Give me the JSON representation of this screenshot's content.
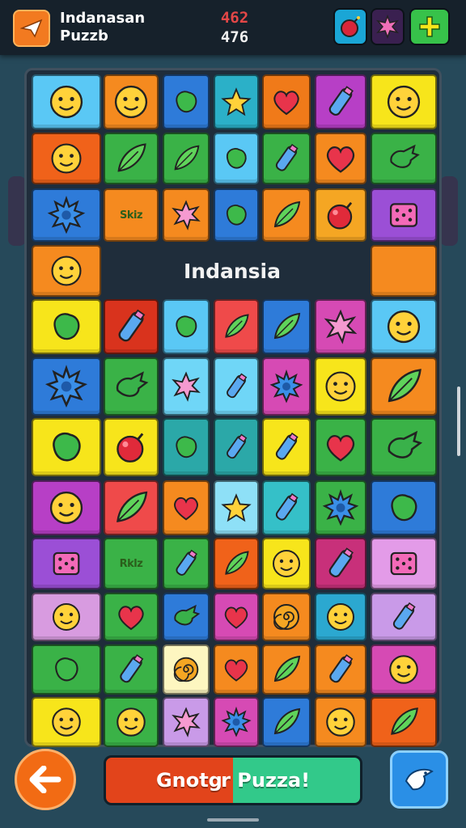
{
  "header": {
    "app_name_line1": "Indanasan",
    "app_name_line2": "Puzzb",
    "score_primary": "462",
    "score_secondary": "476",
    "logo_icon": "paper-plane-icon",
    "buttons": [
      {
        "icon": "bomb-icon",
        "bg": "#1aa6d6"
      },
      {
        "icon": "star-burst-icon",
        "bg": "#3a2050"
      },
      {
        "icon": "plus-icon",
        "bg": "#37c24a"
      }
    ]
  },
  "board": {
    "banner_title": "Indansia",
    "tiles": [
      {
        "c": "#5ac8f5",
        "icon": "smiley-face-icon"
      },
      {
        "c": "#f58a1f",
        "icon": "smiley-face-icon"
      },
      {
        "c": "#2e7bd9",
        "icon": "blob-icon"
      },
      {
        "c": "#2bb0c8",
        "icon": "star-icon"
      },
      {
        "c": "#f07a19",
        "icon": "heart-icon"
      },
      {
        "c": "#b73fc6",
        "icon": "bottle-icon"
      },
      {
        "c": "#f7e51b",
        "icon": "smiley-face-icon"
      },
      {
        "c": "#f0621a",
        "icon": "smiley-face-icon"
      },
      {
        "c": "#3ab247",
        "icon": "leaf-icon"
      },
      {
        "c": "#3ab247",
        "icon": "leaf-icon"
      },
      {
        "c": "#5ac8f5",
        "icon": "blob-icon"
      },
      {
        "c": "#3ab247",
        "icon": "bottle-icon"
      },
      {
        "c": "#f58a1f",
        "icon": "heart-icon"
      },
      {
        "c": "#3ab247",
        "icon": "hand-icon"
      },
      {
        "c": "#2e7bd9",
        "icon": "spiky-ball-icon"
      },
      {
        "c": "#f58a1f",
        "text": "Skiz"
      },
      {
        "c": "#f58a1f",
        "icon": "star-burst-icon"
      },
      {
        "c": "#2e7bd9",
        "icon": "blob-icon"
      },
      {
        "c": "#f58a1f",
        "icon": "leaf-icon"
      },
      {
        "c": "#f5a623",
        "icon": "bomb-icon"
      },
      {
        "c": "#9b4fd6",
        "icon": "dice-icon"
      },
      {
        "c": "#f58a1f",
        "icon": "smiley-face-icon"
      },
      {
        "c": "#f58a1f",
        "icon": "none"
      },
      {
        "c": "#f7e51b",
        "icon": "blob-icon"
      },
      {
        "c": "#d9331d",
        "icon": "bottle-icon"
      },
      {
        "c": "#5ac8f5",
        "icon": "blob-icon"
      },
      {
        "c": "#ef4a4a",
        "icon": "leaf-icon"
      },
      {
        "c": "#2e7bd9",
        "icon": "leaf-icon"
      },
      {
        "c": "#d64ab4",
        "icon": "star-burst-icon"
      },
      {
        "c": "#5ac8f5",
        "icon": "smiley-face-icon"
      },
      {
        "c": "#2e7bd9",
        "icon": "spiky-ball-icon"
      },
      {
        "c": "#3ab247",
        "icon": "hand-icon"
      },
      {
        "c": "#6fd6f7",
        "icon": "star-burst-icon"
      },
      {
        "c": "#6fd6f7",
        "icon": "bottle-icon"
      },
      {
        "c": "#d64ab4",
        "icon": "spiky-ball-icon"
      },
      {
        "c": "#f7e51b",
        "icon": "smiley-face-icon"
      },
      {
        "c": "#f58a1f",
        "icon": "leaf-icon"
      },
      {
        "c": "#f7e51b",
        "icon": "blob-icon"
      },
      {
        "c": "#f7e51b",
        "icon": "bomb-icon"
      },
      {
        "c": "#2ba8a8",
        "icon": "blob-icon"
      },
      {
        "c": "#2ba8a8",
        "icon": "bottle-icon"
      },
      {
        "c": "#f7e51b",
        "icon": "bottle-icon"
      },
      {
        "c": "#3ab247",
        "icon": "heart-icon"
      },
      {
        "c": "#3ab247",
        "icon": "hand-icon"
      },
      {
        "c": "#b73fc6",
        "icon": "smiley-face-icon"
      },
      {
        "c": "#ef4a4a",
        "icon": "leaf-icon"
      },
      {
        "c": "#f58a1f",
        "icon": "heart-icon"
      },
      {
        "c": "#8ee0f7",
        "icon": "star-icon"
      },
      {
        "c": "#35c0c8",
        "icon": "bottle-icon"
      },
      {
        "c": "#3ab247",
        "icon": "spiky-ball-icon"
      },
      {
        "c": "#2e7bd9",
        "icon": "blob-icon"
      },
      {
        "c": "#9b4fd6",
        "icon": "dice-icon"
      },
      {
        "c": "#3ab247",
        "text": "Rklz"
      },
      {
        "c": "#3ab247",
        "icon": "bottle-icon"
      },
      {
        "c": "#f0621a",
        "icon": "leaf-icon"
      },
      {
        "c": "#f7e51b",
        "icon": "smiley-face-icon"
      },
      {
        "c": "#c8307a",
        "icon": "bottle-icon"
      },
      {
        "c": "#e39be8",
        "icon": "dice-icon"
      },
      {
        "c": "#d89be0",
        "icon": "smiley-face-icon"
      },
      {
        "c": "#3ab247",
        "icon": "heart-icon"
      },
      {
        "c": "#2e7bd9",
        "icon": "hand-icon"
      },
      {
        "c": "#d64ab4",
        "icon": "heart-icon"
      },
      {
        "c": "#f58a1f",
        "icon": "spiral-icon"
      },
      {
        "c": "#2ba8d0",
        "icon": "smiley-face-icon"
      },
      {
        "c": "#c99ae8",
        "icon": "bottle-icon"
      },
      {
        "c": "#3ab247",
        "icon": "blob-icon"
      },
      {
        "c": "#3ab247",
        "icon": "bottle-icon"
      },
      {
        "c": "#fdf6c0",
        "icon": "spiral-icon"
      },
      {
        "c": "#f58a1f",
        "icon": "heart-icon"
      },
      {
        "c": "#f58a1f",
        "icon": "leaf-icon"
      },
      {
        "c": "#f58a1f",
        "icon": "bottle-icon"
      },
      {
        "c": "#d64ab4",
        "icon": "smiley-face-icon"
      },
      {
        "c": "#f7e51b",
        "icon": "smiley-face-icon"
      },
      {
        "c": "#3ab247",
        "icon": "smiley-face-icon"
      },
      {
        "c": "#c99ae8",
        "icon": "star-burst-icon"
      },
      {
        "c": "#d64ab4",
        "icon": "spiky-ball-icon"
      },
      {
        "c": "#2e7bd9",
        "icon": "leaf-icon"
      },
      {
        "c": "#f58a1f",
        "icon": "smiley-face-icon"
      },
      {
        "c": "#f0621a",
        "icon": "leaf-icon"
      }
    ]
  },
  "footer": {
    "back_icon": "arrow-left-icon",
    "new_puzzle_label": "Gnotցr Puzza!",
    "hint_icon": "bird-icon"
  }
}
